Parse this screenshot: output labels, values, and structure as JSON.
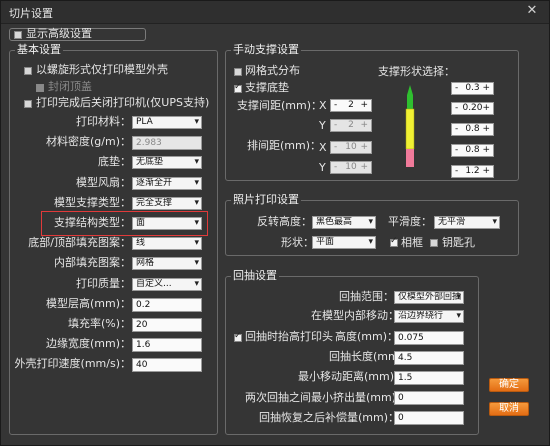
{
  "window": {
    "title": "切片设置",
    "close_icon": "close-icon"
  },
  "show_advanced": "显示高级设置",
  "basic": {
    "title": "基本设置",
    "spiral_label": "以螺旋形式仅打印模型外壳",
    "seal_top_label": "封闭顶盖",
    "shutdown_label": "打印完成后关闭打印机(仅UPS支持)",
    "rows": [
      {
        "label": "打印材料：",
        "type": "select",
        "value": "PLA"
      },
      {
        "label": "材料密度(g/m)：",
        "type": "input",
        "value": "2.983",
        "dim": true
      },
      {
        "label": "底垫：",
        "type": "select",
        "value": "无底垫"
      },
      {
        "label": "模型风扇：",
        "type": "select",
        "value": "逐渐全开"
      },
      {
        "label": "模型支撑类型：",
        "type": "select",
        "value": "完全支撑"
      },
      {
        "label": "支撑结构类型：",
        "type": "select",
        "value": "面"
      },
      {
        "label": "底部/顶部填充图案：",
        "type": "select",
        "value": "线"
      },
      {
        "label": "内部填充图案：",
        "type": "select",
        "value": "网格"
      },
      {
        "label": "打印质量：",
        "type": "select",
        "value": "自定义..."
      },
      {
        "label": "模型层高(mm)：",
        "type": "input",
        "value": "0.2"
      },
      {
        "label": "填充率(%)：",
        "type": "input",
        "value": "20"
      },
      {
        "label": "边缘宽度(mm)：",
        "type": "input",
        "value": "1.6"
      },
      {
        "label": "外壳打印速度(mm/s)：",
        "type": "input",
        "value": "40"
      }
    ]
  },
  "manual_support": {
    "title": "手动支撑设置",
    "grid_label": "网格式分布",
    "base_label": "支撑底垫",
    "spacing_label": "支撑间距(mm)：",
    "row_spacing_label": "排间距(mm)：",
    "x": "X",
    "y": "Y",
    "spacing_x": "2",
    "spacing_y": "2",
    "row_x": "10",
    "row_y": "10",
    "shape_label": "支撑形状选择：",
    "shape_values": [
      "0.3",
      "0.20",
      "0.8",
      "0.8",
      "1.2"
    ],
    "minus": "-",
    "plus": "+"
  },
  "photo": {
    "title": "照片打印设置",
    "reverse_label": "反转高度：",
    "reverse_value": "黑色最高",
    "smooth_label": "平滑度：",
    "smooth_value": "无平滑",
    "shape_label": "形状：",
    "shape_value": "平面",
    "frame_label": "相框",
    "keyhole_label": "钥匙孔"
  },
  "retract": {
    "title": "回抽设置",
    "range_label": "回抽范围：",
    "range_value": "仅模型外部回抽",
    "inner_label": "在模型内部移动：",
    "inner_value": "沿边界绕行",
    "lift_label": "回抽时抬高打印头",
    "height_label": "高度(mm)：",
    "height_value": "0.075",
    "length_label": "回抽长度(mm)：",
    "length_value": "4.5",
    "min_move_label": "最小移动距离(mm)：",
    "min_move_value": "1.5",
    "min_extrude_label": "两次回抽之间最小挤出量(mm)：",
    "min_extrude_value": "0",
    "compensate_label": "回抽恢复之后补偿量(mm)：",
    "compensate_value": "0"
  },
  "buttons": {
    "ok": "确定",
    "cancel": "取消"
  },
  "colors": {
    "accent": "#e36d14",
    "highlight": "#e03a3a"
  }
}
